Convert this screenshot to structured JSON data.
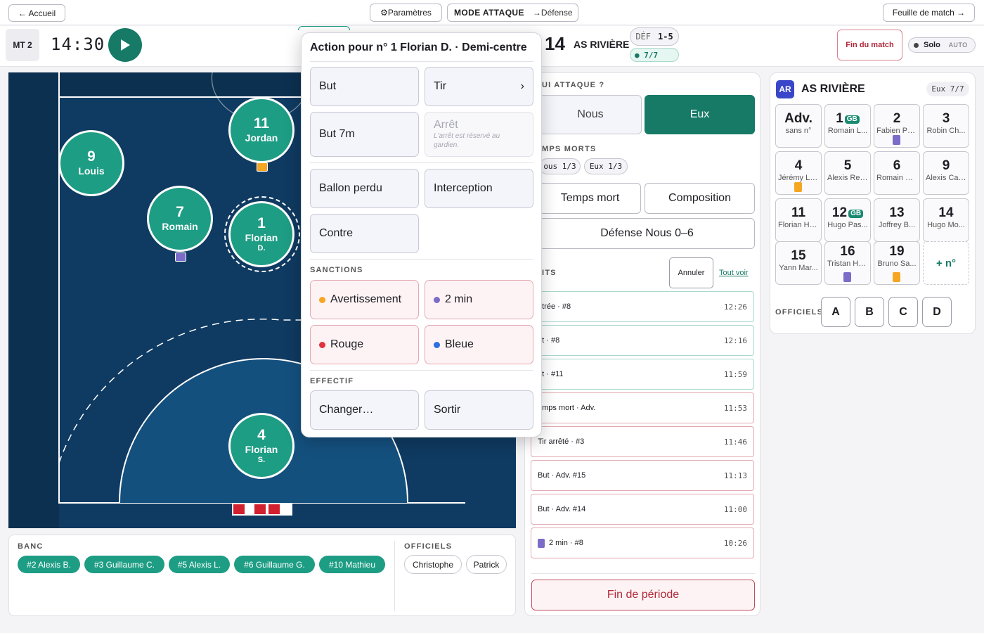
{
  "topbar": {
    "home": "← Accueil",
    "settings": "⚙Paramètres",
    "mode_label": "MODE ATTAQUE",
    "mode_switch": "→Défense",
    "sheet": "Feuille de match →"
  },
  "header": {
    "period": "MT 2",
    "clock": "14:30",
    "score_away": "14",
    "team_name": "AS RIVIÈRE",
    "def_label": "DÉF",
    "def_value": "1-5",
    "count": "● 7/7",
    "end_match": "Fin du match",
    "solo": "Solo",
    "auto": "AUTO"
  },
  "field": {
    "players": [
      {
        "num": "9",
        "name": "Louis",
        "name2": ""
      },
      {
        "num": "11",
        "name": "Jordan",
        "name2": ""
      },
      {
        "num": "7",
        "name": "Romain",
        "name2": ""
      },
      {
        "num": "1",
        "name": "Florian",
        "name2": "D."
      },
      {
        "num": "4",
        "name": "Florian",
        "name2": "S."
      }
    ]
  },
  "bench": {
    "title": "BANC",
    "players": [
      "#2 Alexis B.",
      "#3 Guillaume C.",
      "#5 Alexis L.",
      "#6 Guillaume G.",
      "#10 Mathieu"
    ],
    "officials_title": "OFFICIELS",
    "officials": [
      "Christophe",
      "Patrick"
    ]
  },
  "modal": {
    "title": "Action pour n° 1 Florian D. · Demi-centre",
    "but": "But",
    "tir": "Tir",
    "tir_chevron": "›",
    "but7m": "But 7m",
    "arret": "Arrêt",
    "arret_note": "L'arrêt est réservé au gardien.",
    "ballon_perdu": "Ballon perdu",
    "interception": "Interception",
    "contre": "Contre",
    "sanctions_title": "SANCTIONS",
    "avertissement": "Avertissement",
    "deux_min": "2 min",
    "rouge": "Rouge",
    "bleue": "Bleue",
    "effectif_title": "EFFECTIF",
    "changer": "Changer…",
    "sortir": "Sortir"
  },
  "middle": {
    "attack_q": "UI ATTAQUE ?",
    "nous": "Nous",
    "eux": "Eux",
    "timeouts_title": "MPS MORTS",
    "nous_to": "ous 1/3",
    "eux_to": "Eux 1/3",
    "temps_mort": "Temps mort",
    "composition": "Composition",
    "defense": "Défense Nous 0–6",
    "events_title": "ITS",
    "annuler": "Annuler",
    "tout_voir": "Tout voir",
    "events": [
      {
        "text": "ntrée · #8",
        "time": "12:26"
      },
      {
        "text": "ut · #8",
        "time": "12:16"
      },
      {
        "text": "ut · #11",
        "time": "11:59"
      },
      {
        "text": "emps mort · Adv.",
        "time": "11:53"
      },
      {
        "text": "Tir arrêté · #3",
        "time": "11:46"
      },
      {
        "text": "But · Adv. #15",
        "time": "11:13"
      },
      {
        "text": "But · Adv. #14",
        "time": "11:00"
      },
      {
        "text": "2 min · #8",
        "time": "10:26"
      }
    ],
    "end_period": "Fin de période"
  },
  "roster": {
    "badge": "AR",
    "team": "AS RIVIÈRE",
    "count": "Eux  7/7",
    "adv_num": "Adv.",
    "adv_sub": "sans n°",
    "gb": "GB",
    "players": [
      {
        "num": "1",
        "name": "Romain L..."
      },
      {
        "num": "2",
        "name": "Fabien Pa..."
      },
      {
        "num": "3",
        "name": "Robin Ch..."
      },
      {
        "num": "4",
        "name": "Jérémy La..."
      },
      {
        "num": "5",
        "name": "Alexis Rey..."
      },
      {
        "num": "6",
        "name": "Romain G..."
      },
      {
        "num": "9",
        "name": "Alexis Car..."
      },
      {
        "num": "11",
        "name": "Florian He..."
      },
      {
        "num": "12",
        "name": "Hugo Pas..."
      },
      {
        "num": "13",
        "name": "Joffrey B..."
      },
      {
        "num": "14",
        "name": "Hugo Mo..."
      },
      {
        "num": "15",
        "name": "Yann Mar..."
      },
      {
        "num": "16",
        "name": "Tristan He..."
      },
      {
        "num": "19",
        "name": "Bruno Sa..."
      }
    ],
    "add": "+ n°",
    "officials_title": "OFFICIELS",
    "officials": [
      "A",
      "B",
      "C",
      "D"
    ]
  },
  "colors": {
    "teal": "#1d9d84",
    "dark_teal": "#167a66",
    "navy": "#0f3a61",
    "red": "#b0283a",
    "orange": "#f5a623",
    "purple": "#7b6cc7"
  }
}
